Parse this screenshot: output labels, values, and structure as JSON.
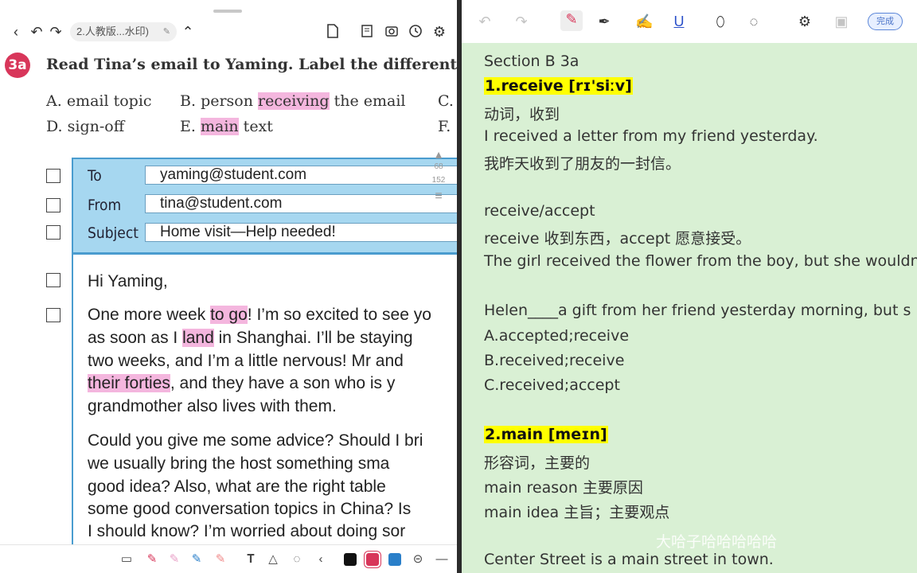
{
  "left": {
    "doc_tab": "2.人教版...水印)",
    "badge": "3a",
    "instruction": "Read Tina’s email to Yaming. Label the different par",
    "options": [
      {
        "letter": "A.",
        "pre": "email topic",
        "hl": "",
        "post": ""
      },
      {
        "letter": "B.",
        "pre": "person ",
        "hl": "receiving",
        "post": " the email"
      },
      {
        "letter": "C.",
        "pre": "",
        "hl": "",
        "post": ""
      },
      {
        "letter": "D.",
        "pre": "sign-off",
        "hl": "",
        "post": ""
      },
      {
        "letter": "E.",
        "pre": "",
        "hl": "main",
        "post": " text"
      },
      {
        "letter": "F.",
        "pre": "",
        "hl": "",
        "post": ""
      }
    ],
    "email": {
      "to_label": "To",
      "to_value": "yaming@student.com",
      "from_label": "From",
      "from_value": "tina@student.com",
      "subject_label": "Subject",
      "subject_value": "Home visit—Help needed!",
      "greeting": "Hi Yaming,",
      "p1": [
        {
          "a": "One more week ",
          "hl": "to go",
          "b": "! I’m so excited to see yo"
        },
        {
          "a": "as soon as I ",
          "hl": "land",
          "b": " in Shanghai. I’ll be staying"
        },
        {
          "a": "two weeks, and I’m a little nervous! Mr and",
          "hl": "",
          "b": ""
        },
        {
          "a": "",
          "hl": "their forties",
          "b": ", and they have a son who is y"
        },
        {
          "a": "grandmother also lives with them.",
          "hl": "",
          "b": ""
        }
      ],
      "p2": [
        "Could you give me some advice? Should I bri",
        "we usually bring the host something sma",
        "good idea? Also, what are the right table",
        "some good conversation topics in China? Is",
        "I should know? I’m worried about doing sor"
      ]
    },
    "scroll_numbers": [
      "68",
      "152"
    ]
  },
  "right": {
    "done_label": "完成",
    "lines": [
      {
        "text": "Section B 3a",
        "style": "normal"
      },
      {
        "text": "1.receive [rɪ'siːv]",
        "style": "highlight"
      },
      {
        "text": "动词，收到",
        "style": "normal"
      },
      {
        "text": "I received a letter from my friend yesterday.",
        "style": "normal"
      },
      {
        "text": "我昨天收到了朋友的一封信。",
        "style": "normal"
      },
      {
        "text": "",
        "style": "blank"
      },
      {
        "text": "receive/accept",
        "style": "normal"
      },
      {
        "text": "receive 收到东西，accept 愿意接受。",
        "style": "normal"
      },
      {
        "text": "The girl received the flower from the boy, but she wouldn",
        "style": "normal"
      },
      {
        "text": "",
        "style": "blank"
      },
      {
        "text": "Helen____a gift from her friend yesterday morning, but s",
        "style": "normal"
      },
      {
        "text": "A.accepted;receive",
        "style": "normal"
      },
      {
        "text": "B.received;receive",
        "style": "normal"
      },
      {
        "text": "C.received;accept",
        "style": "normal"
      },
      {
        "text": "",
        "style": "blank"
      },
      {
        "text": "2.main [meɪn]",
        "style": "highlight"
      },
      {
        "text": "形容词，主要的",
        "style": "normal"
      },
      {
        "text": "main reason  主要原因",
        "style": "normal"
      },
      {
        "text": "main idea  主旨；主要观点",
        "style": "normal"
      },
      {
        "text": "",
        "style": "blank"
      },
      {
        "text": "Center Street is a main street in town.",
        "style": "normal"
      }
    ],
    "watermark": "大哈子哈哈哈哈哈"
  },
  "colors": {
    "highlight_pink": "#f4b6de",
    "highlight_yellow": "#ffff00",
    "note_bg": "#d9f0d4",
    "email_header_blue": "#a6d7f0",
    "badge_red": "#d8365a",
    "swatches": [
      "#111111",
      "#d8365a",
      "#2a7fc9"
    ]
  }
}
